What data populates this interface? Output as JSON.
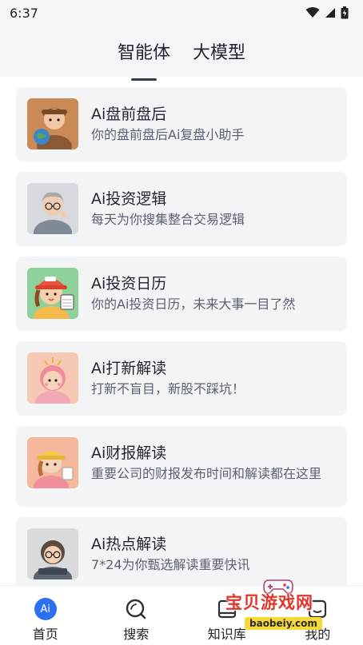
{
  "status_bar": {
    "time": "6:37"
  },
  "header": {
    "tabs": [
      {
        "label": "智能体",
        "active": true
      },
      {
        "label": "大模型",
        "active": false
      }
    ]
  },
  "cards": [
    {
      "title": "Ai盘前盘后",
      "desc": "你的盘前盘后Ai复盘小助手",
      "avatar": "explorer-avatar-icon"
    },
    {
      "title": "Ai投资逻辑",
      "desc": "每天为你搜集整合交易逻辑",
      "avatar": "elder-thinker-avatar-icon"
    },
    {
      "title": "Ai投资日历",
      "desc": "你的Ai投资日历，未来大事一目了然",
      "avatar": "cap-girl-calendar-avatar-icon"
    },
    {
      "title": "Ai打新解读",
      "desc": "打新不盲目，新股不踩坑！",
      "avatar": "pink-hair-girl-avatar-icon"
    },
    {
      "title": "Ai财报解读",
      "desc": "重要公司的财报发布时间和解读都在这里",
      "avatar": "yellow-cap-girl-avatar-icon"
    },
    {
      "title": "Ai热点解读",
      "desc": "7*24为你甄选解读重要快讯",
      "avatar": "glasses-girl-avatar-icon"
    }
  ],
  "bottom_nav": [
    {
      "label": "首页",
      "icon": "ai-home-icon",
      "badge": "Ai",
      "active": true
    },
    {
      "label": "搜索",
      "icon": "search-icon"
    },
    {
      "label": "知识库",
      "icon": "book-icon"
    },
    {
      "label": "我的",
      "icon": "profile-icon"
    }
  ],
  "watermark": {
    "text": "宝贝游戏网",
    "url": "baobeiy.com"
  },
  "colors": {
    "accent": "#2d6ff2",
    "card_bg": "#f3f4f6",
    "header_bg": "#f4f5f7",
    "tab_indicator": "#2f3d52"
  }
}
